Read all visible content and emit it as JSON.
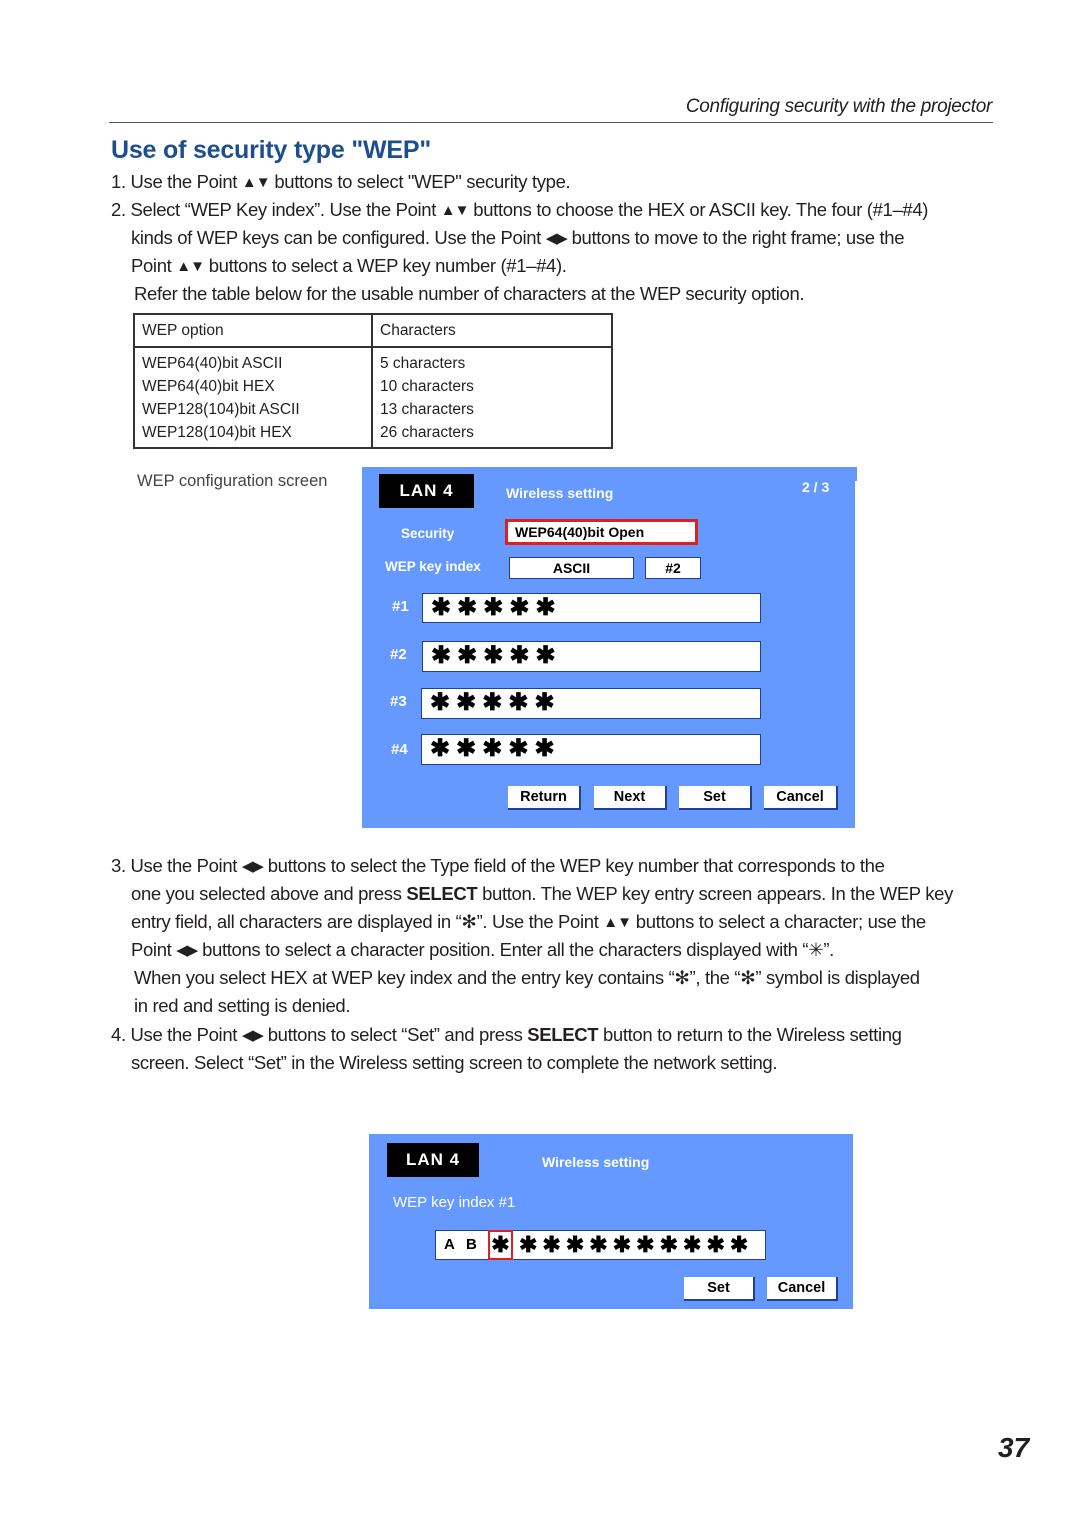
{
  "header": {
    "running_head": "Configuring security with the projector",
    "section_title": "Use of security type \"WEP\""
  },
  "icons": {
    "up_down": "▲▼",
    "left_right": "◀▶"
  },
  "steps": {
    "s1": {
      "num": "1.",
      "a": "Use the Point ",
      "b": " buttons to select \"WEP\" security type."
    },
    "s2": {
      "num": "2.",
      "l1a": "Select “WEP Key index”. Use the Point ",
      "l1b": " buttons to choose the HEX or ASCII key. The four (#1–#4)",
      "l2a": "kinds of WEP keys can be configured. Use the Point ",
      "l2b": " buttons to move to the right frame; use the",
      "l3a": "Point ",
      "l3b": " buttons to select a WEP key number (#1–#4).",
      "note": "Refer the table below for the usable number of characters at the WEP security option."
    },
    "s3": {
      "num": "3.",
      "l1a": "Use the Point ",
      "l1b": " buttons to select the Type field of the WEP key number that corresponds to the",
      "l2a": "one you selected above and press ",
      "l2bold": "SELECT",
      "l2b": " button. The WEP key entry screen appears. In the WEP key",
      "l3a": "entry field, all characters are displayed in “✻”. Use the Point ",
      "l3b": " buttons to select a character; use the",
      "l4a": "Point ",
      "l4b": " buttons to select a character position. Enter all the characters displayed with “✳”.",
      "note1": "When you select HEX at WEP key index and the entry key contains “✻”, the “✻” symbol is displayed",
      "note2": "in red and setting is denied."
    },
    "s4": {
      "num": "4.",
      "l1a": "Use the Point ",
      "l1b": " buttons to select “Set” and press ",
      "l1bold": "SELECT",
      "l1c": " button to return to the Wireless setting",
      "l2": "screen. Select “Set” in the Wireless setting screen to complete the network setting."
    }
  },
  "table": {
    "headers": [
      "WEP option",
      "Characters"
    ],
    "rows": [
      [
        "WEP64(40)bit ASCII",
        "5 characters"
      ],
      [
        "WEP64(40)bit HEX",
        "10 characters"
      ],
      [
        "WEP128(104)bit ASCII",
        "13 characters"
      ],
      [
        "WEP128(104)bit HEX",
        "26 characters"
      ]
    ]
  },
  "config_screen": {
    "caption": "WEP configuration screen",
    "badge": "LAN 4",
    "title": "Wireless setting",
    "page": "2 / 3",
    "security_label": "Security",
    "security_value": "WEP64(40)bit Open",
    "key_index_label": "WEP key index",
    "key_type": "ASCII",
    "key_number": "#2",
    "keys": [
      {
        "label": "#1",
        "value": "✱✱✱✱✱"
      },
      {
        "label": "#2",
        "value": "✱✱✱✱✱"
      },
      {
        "label": "#3",
        "value": "✱✱✱✱✱"
      },
      {
        "label": "#4",
        "value": "✱✱✱✱✱"
      }
    ],
    "buttons": {
      "return": "Return",
      "next": "Next",
      "set": "Set",
      "cancel": "Cancel"
    }
  },
  "entry_screen": {
    "badge": "LAN 4",
    "title": "Wireless setting",
    "key_label": "WEP key index #1",
    "entered": [
      "A",
      "B"
    ],
    "cursor_char": "✱",
    "remaining": "✱✱✱✱✱✱✱✱✱✱",
    "buttons": {
      "set": "Set",
      "cancel": "Cancel"
    }
  },
  "colors": {
    "screen_bg": "#6699ff",
    "highlight": "#e02020",
    "title_blue": "#1d4f8e"
  },
  "page_number": "37"
}
